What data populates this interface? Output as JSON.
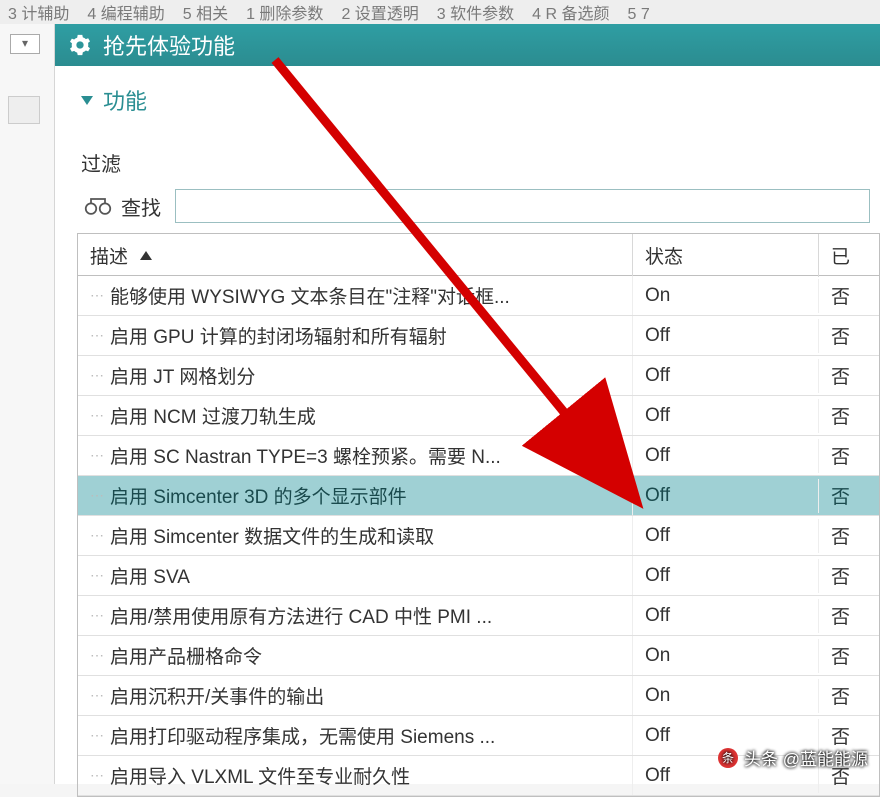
{
  "top_menu": [
    "3 计辅助",
    "4 编程辅助",
    "5 相关",
    "1 删除参数",
    "2 设置透明",
    "3 软件参数",
    "4 R 备选颜",
    "5 7"
  ],
  "title": "抢先体验功能",
  "section": "功能",
  "filter_label": "过滤",
  "search_label": "查找",
  "search_value": "",
  "columns": {
    "desc": "描述",
    "state": "状态",
    "col3": "已"
  },
  "rows": [
    {
      "desc": "能够使用 WYSIWYG 文本条目在\"注释\"对话框...",
      "state": "On",
      "c3": "否",
      "sel": false
    },
    {
      "desc": "启用 GPU 计算的封闭场辐射和所有辐射",
      "state": "Off",
      "c3": "否",
      "sel": false
    },
    {
      "desc": "启用 JT 网格划分",
      "state": "Off",
      "c3": "否",
      "sel": false
    },
    {
      "desc": "启用 NCM 过渡刀轨生成",
      "state": "Off",
      "c3": "否",
      "sel": false
    },
    {
      "desc": "启用 SC Nastran TYPE=3 螺栓预紧。需要 N...",
      "state": "Off",
      "c3": "否",
      "sel": false
    },
    {
      "desc": "启用 Simcenter 3D 的多个显示部件",
      "state": "Off",
      "c3": "否",
      "sel": true
    },
    {
      "desc": "启用 Simcenter 数据文件的生成和读取",
      "state": "Off",
      "c3": "否",
      "sel": false
    },
    {
      "desc": "启用 SVA",
      "state": "Off",
      "c3": "否",
      "sel": false
    },
    {
      "desc": "启用/禁用使用原有方法进行 CAD 中性 PMI ...",
      "state": "Off",
      "c3": "否",
      "sel": false
    },
    {
      "desc": "启用产品栅格命令",
      "state": "On",
      "c3": "否",
      "sel": false
    },
    {
      "desc": "启用沉积开/关事件的输出",
      "state": "On",
      "c3": "否",
      "sel": false
    },
    {
      "desc": "启用打印驱动程序集成，无需使用 Siemens ...",
      "state": "Off",
      "c3": "否",
      "sel": false
    },
    {
      "desc": "启用导入 VLXML 文件至专业耐久性",
      "state": "Off",
      "c3": "否",
      "sel": false
    }
  ],
  "watermark": "头条 @蓝能能源"
}
